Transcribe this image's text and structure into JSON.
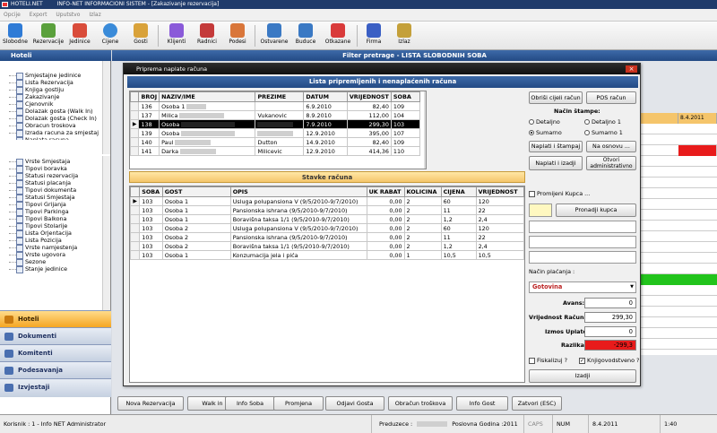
{
  "app": {
    "title": "HOTELI.NET",
    "subtitle": "INFO-NET INFORMACIONI SISTEM - [Zakazivanje rezervacija]"
  },
  "menu": [
    "Opcije",
    "Export",
    "Uputstvo",
    "Izlaz"
  ],
  "toolbar": [
    {
      "label": "Slobodne",
      "color": "#2f7bd6"
    },
    {
      "label": "Rezervacije",
      "color": "#5aa03c"
    },
    {
      "label": "Jedinice",
      "color": "#d94c3a"
    },
    {
      "label": "Cijene",
      "color": "#3a8bd9"
    },
    {
      "label": "Gosti",
      "color": "#d9a23a"
    },
    {
      "label": "Klijenti",
      "color": "#8a5ad9"
    },
    {
      "label": "Radnici",
      "color": "#c43a3a"
    },
    {
      "label": "Podesi",
      "color": "#d9763a"
    },
    {
      "label": "Ostvarene",
      "color": "#3a79c4"
    },
    {
      "label": "Buduce",
      "color": "#3a79c4"
    },
    {
      "label": "Otkazane",
      "color": "#d93a3a"
    },
    {
      "label": "Firma",
      "color": "#3a5fc4"
    },
    {
      "label": "Izlaz",
      "color": "#c4a03a"
    }
  ],
  "sidebar": {
    "title": "Hoteli",
    "tree1": [
      "Smjestajne jedinice",
      "Lista Rezervacija",
      "Knjiga gostiju",
      "Zakazivanje",
      "Cjenovnik",
      "Dolazak gosta (Walk In)",
      "Dolazak gosta (Check In)",
      "Obracun troskova",
      "Izrada racuna za smjestaj",
      "Naplata racuna"
    ],
    "tree2": [
      "Vrste Smjestaja",
      "Tipovi boravka",
      "Statusi rezervacija",
      "Statusi placanja",
      "Tipovi dokumenta",
      "Statusi Smjestaja",
      "Tipovi Grijanja",
      "Tipovi Parkinga",
      "Tipovi Balkona",
      "Tipovi Stolarije",
      "Lista Orjentacija",
      "Lista Pozicija",
      "Vrste namjestenja",
      "Vrste ugovora",
      "Sezone",
      "Stanje jedinice"
    ],
    "nav": [
      "Hoteli",
      "Dokumenti",
      "Komitenti",
      "Podesavanja",
      "Izvjestaji"
    ]
  },
  "main": {
    "filter_title": "Filter pretrage - LISTA SLOBODNIH SOBA",
    "calendar": {
      "headers": [
        "",
        "8.4.2011"
      ]
    }
  },
  "dialog": {
    "title": "Priprema naplate računa",
    "header": "Lista pripremljenih i nenaplaćenih računa",
    "accounts_table": {
      "columns": [
        "BROJ",
        "NAZIV/IME",
        "PREZIME",
        "DATUM",
        "VRIJEDNOST",
        "SOBA"
      ],
      "rows": [
        {
          "broj": "136",
          "naziv": "Osoba 1",
          "prezime": "",
          "datum": "6.9.2010",
          "vrijednost": "82,40",
          "soba": "109"
        },
        {
          "broj": "137",
          "naziv": "Milica",
          "prezime": "Vukanovic",
          "datum": "8.9.2010",
          "vrijednost": "112,00",
          "soba": "104"
        },
        {
          "broj": "138",
          "naziv": "Osoba",
          "prezime": "",
          "datum": "7.9.2010",
          "vrijednost": "299,30",
          "soba": "103"
        },
        {
          "broj": "139",
          "naziv": "Osoba",
          "prezime": "",
          "datum": "12.9.2010",
          "vrijednost": "395,00",
          "soba": "107"
        },
        {
          "broj": "140",
          "naziv": "Paul",
          "prezime": "Dutton",
          "datum": "14.9.2010",
          "vrijednost": "82,40",
          "soba": "109"
        },
        {
          "broj": "141",
          "naziv": "Darka",
          "prezime": "Milicevic",
          "datum": "12.9.2010",
          "vrijednost": "414,36",
          "soba": "110"
        }
      ]
    },
    "stavke_header": "Stavke računa",
    "items_table": {
      "columns": [
        "SOBA",
        "GOST",
        "OPIS",
        "UK RABAT",
        "KOLICINA",
        "CIJENA",
        "VRIJEDNOST"
      ],
      "rows": [
        {
          "soba": "103",
          "gost": "Osoba 1",
          "opis": "Usluga polupansiona V (9/5/2010-9/7/2010)",
          "rabat": "0,00",
          "kol": "2",
          "cijena": "60",
          "vrijednost": "120"
        },
        {
          "soba": "103",
          "gost": "Osoba 1",
          "opis": "Pansionska ishrana (9/5/2010-9/7/2010)",
          "rabat": "0,00",
          "kol": "2",
          "cijena": "11",
          "vrijednost": "22"
        },
        {
          "soba": "103",
          "gost": "Osoba 1",
          "opis": "Boravišna taksa 1/1 (9/5/2010-9/7/2010)",
          "rabat": "0,00",
          "kol": "2",
          "cijena": "1,2",
          "vrijednost": "2,4"
        },
        {
          "soba": "103",
          "gost": "Osoba 2",
          "opis": "Usluga polupansiona V (9/5/2010-9/7/2010)",
          "rabat": "0,00",
          "kol": "2",
          "cijena": "60",
          "vrijednost": "120"
        },
        {
          "soba": "103",
          "gost": "Osoba 2",
          "opis": "Pansionska ishrana (9/5/2010-9/7/2010)",
          "rabat": "0,00",
          "kol": "2",
          "cijena": "11",
          "vrijednost": "22"
        },
        {
          "soba": "103",
          "gost": "Osoba 2",
          "opis": "Boravišna taksa 1/1 (9/5/2010-9/7/2010)",
          "rabat": "0,00",
          "kol": "2",
          "cijena": "1,2",
          "vrijednost": "2,4"
        },
        {
          "soba": "103",
          "gost": "Osoba 1",
          "opis": "Konzumacija jela i pića",
          "rabat": "0,00",
          "kol": "1",
          "cijena": "10,5",
          "vrijednost": "10,5"
        }
      ]
    },
    "right": {
      "btn_obrisi": "Obriši cijeli račun",
      "btn_pos": "POS račun",
      "nacin_stampe": "Način štampe:",
      "radio_detaljno": "Detaljno",
      "radio_detaljno1": "Detaljno 1",
      "radio_sumarno": "Sumarno",
      "radio_sumarno1": "Sumarno 1",
      "btn_naplati_stampaj": "Naplati i štampaj",
      "btn_na_osnovu": "Na osnovu ...",
      "btn_naplati_izadji": "Naplati i izadji",
      "btn_otvori": "Otvori administrativno",
      "promijeni_kupca": "Promijeni Kupca ...",
      "btn_pronadji": "Pronadji kupca",
      "nacin_placanja": "Način plaćanja :",
      "placanje_value": "Gotovina",
      "avans_label": "Avans:",
      "avans_value": "0",
      "vrijednost_label": "Vrijednost Računa :",
      "vrijednost_value": "299,30",
      "izmos_label": "Izmos Uplate :",
      "izmos_value": "0",
      "razlika_label": "Razlika :",
      "razlika_value": "-299,3",
      "fiskalizuj": "Fiskalizuj ?",
      "knjigovodstveno": "Knjigovodstveno ?",
      "btn_izadji": "Izadji"
    }
  },
  "bottom_buttons": [
    "Nova Rezervacija",
    "Walk in",
    "Info Soba",
    "Promjena",
    "Odjavi Gosta",
    "Obračun troškova",
    "Info Gost",
    "Zatvori (ESC)"
  ],
  "status": {
    "korisnik": "Korisnik : 1 - Info NET  Administrator",
    "preduzece": "Preduzece :",
    "godina": "Poslovna Godina :2011",
    "caps": "CAPS",
    "num": "NUM",
    "date": "8.4.2011",
    "time": "1:40"
  },
  "colors": {
    "accent": "#234a84",
    "highlight": "#f5c56b",
    "danger": "#e81b1b",
    "ok": "#22c41c"
  }
}
